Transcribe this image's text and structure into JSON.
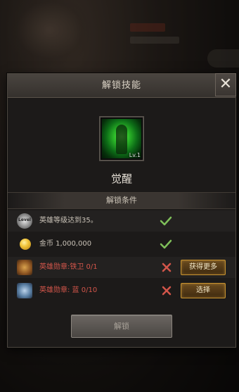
{
  "dialog": {
    "title": "解锁技能",
    "close_label": "✕"
  },
  "skill": {
    "name": "觉醒",
    "level": "Lv.1",
    "icon": "awakening-skill-icon"
  },
  "conditions": {
    "header": "解锁条件",
    "items": [
      {
        "icon": "hero-level-icon",
        "icon_text": "Level",
        "text": "英雄等级达到35。",
        "met": true
      },
      {
        "icon": "gold-coin-icon",
        "text": "金币 1,000,000",
        "met": true
      },
      {
        "icon": "iron-guard-medal-icon",
        "text": "英雄勋章:铁卫 0/1",
        "met": false,
        "action": "获得更多"
      },
      {
        "icon": "blue-medal-icon",
        "text": "英雄勋章: 蓝 0/10",
        "met": false,
        "action": "选择"
      }
    ]
  },
  "unlock_button": "解锁",
  "colors": {
    "met": "#7fbf5a",
    "unmet": "#d2554a",
    "gold_button_border": "#c8932f"
  }
}
